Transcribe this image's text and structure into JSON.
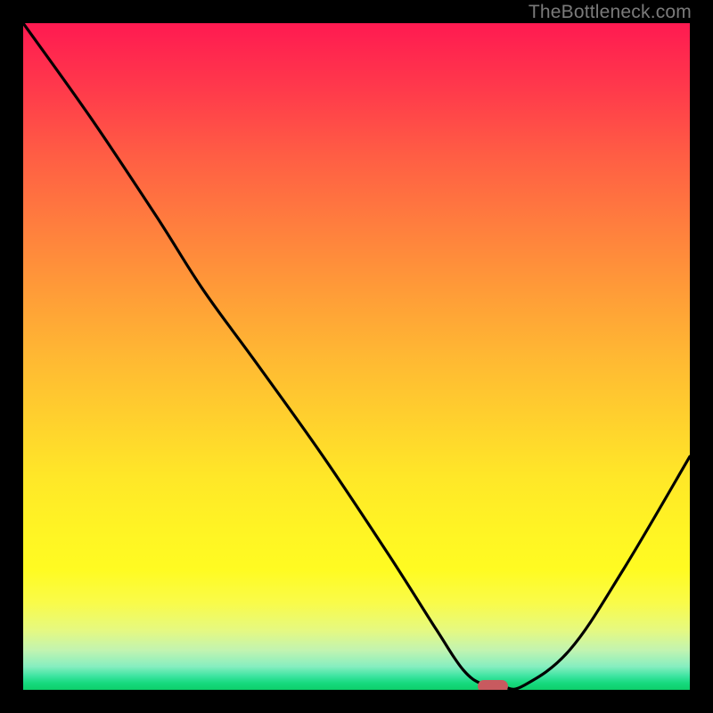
{
  "watermark": "TheBottleneck.com",
  "chart_data": {
    "type": "line",
    "title": "",
    "xlabel": "",
    "ylabel": "",
    "xlim": [
      0,
      100
    ],
    "ylim": [
      0,
      100
    ],
    "grid": false,
    "background": "rainbow-gradient",
    "series": [
      {
        "name": "bottleneck-curve",
        "x": [
          0,
          10,
          20,
          27,
          35,
          45,
          55,
          62,
          66,
          69,
          72,
          75,
          82,
          90,
          100
        ],
        "y": [
          100,
          86,
          71,
          60,
          49,
          35,
          20,
          9,
          3,
          0.8,
          0.4,
          0.6,
          6,
          18,
          35
        ]
      }
    ],
    "marker": {
      "x": 70.5,
      "y": 0.5,
      "shape": "pill",
      "color": "#c85a5f"
    }
  }
}
